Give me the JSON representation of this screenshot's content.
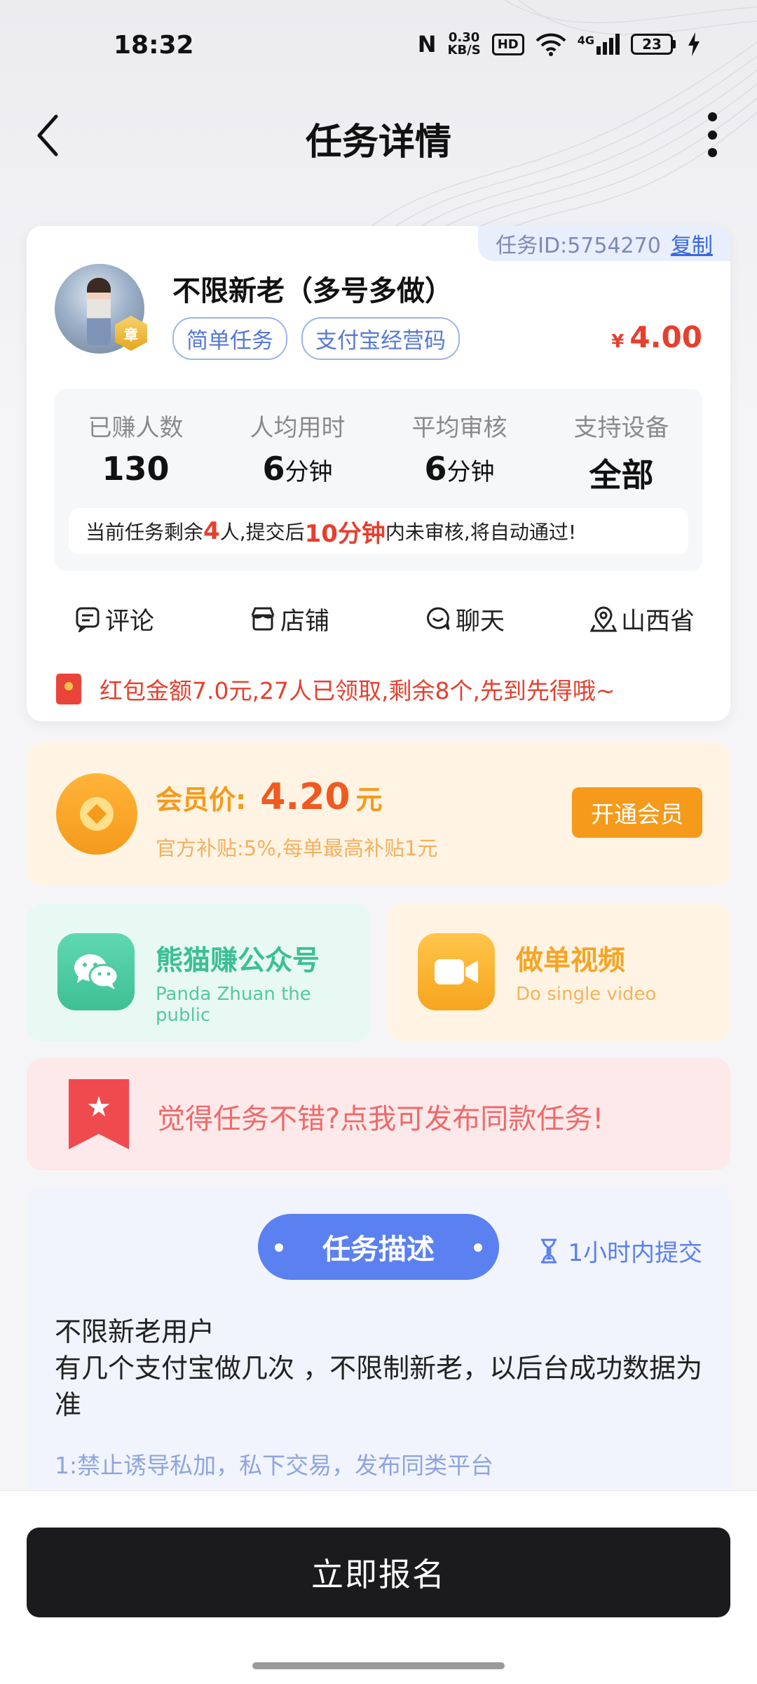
{
  "status_bar": {
    "time": "18:32",
    "nfc": "N",
    "net_speed_value": "0.30",
    "net_speed_unit": "KB/S",
    "hd": "HD",
    "signal": "4G",
    "battery": "23"
  },
  "nav": {
    "title": "任务详情"
  },
  "task": {
    "id_label": "任务ID:5754270",
    "copy_label": "复制",
    "badge_text": "章",
    "title": "不限新老（多号多做）",
    "tags": [
      "简单任务",
      "支付宝经营码"
    ],
    "price_currency": "¥",
    "price": "4.00",
    "stats": [
      {
        "label": "已赚人数",
        "value": "130",
        "unit": ""
      },
      {
        "label": "人均用时",
        "value": "6",
        "unit": "分钟"
      },
      {
        "label": "平均审核",
        "value": "6",
        "unit": "分钟"
      },
      {
        "label": "支持设备",
        "value": "全部",
        "unit": ""
      }
    ],
    "notice": {
      "part1": "当前任务剩余",
      "remain": "4",
      "part2": "人,提交后",
      "minutes": "10分钟",
      "part3": "内未审核,将自动通过!"
    },
    "actions": [
      "评论",
      "店铺",
      "聊天",
      "山西省"
    ],
    "red_packet": "红包金额7.0元,27人已领取,剩余8个,先到先得哦~"
  },
  "member": {
    "label": "会员价:",
    "price": "4.20",
    "unit": "元",
    "subsidy": "官方补贴:5%,每单最高补贴1元",
    "button": "开通会员"
  },
  "panda": {
    "title": "熊猫赚公众号",
    "subtitle": "Panda Zhuan the public"
  },
  "video": {
    "title": "做单视频",
    "subtitle": "Do single video"
  },
  "publish": {
    "text": "觉得任务不错?点我可发布同款任务!"
  },
  "description": {
    "pill": "任务描述",
    "deadline": "1小时内提交",
    "line1": "不限新老用户",
    "line2": "有几个支付宝做几次 ，不限制新老，以后台成功数据为准",
    "rule": "1:禁止诱导私加，私下交易，发布同类平台"
  },
  "bottom": {
    "signup": "立即报名"
  },
  "colors": {
    "accent_red": "#e5402f",
    "accent_orange": "#f59a1b",
    "accent_blue": "#5b80f0",
    "accent_green": "#3bbf93",
    "button_dark": "#1b1b1d"
  }
}
